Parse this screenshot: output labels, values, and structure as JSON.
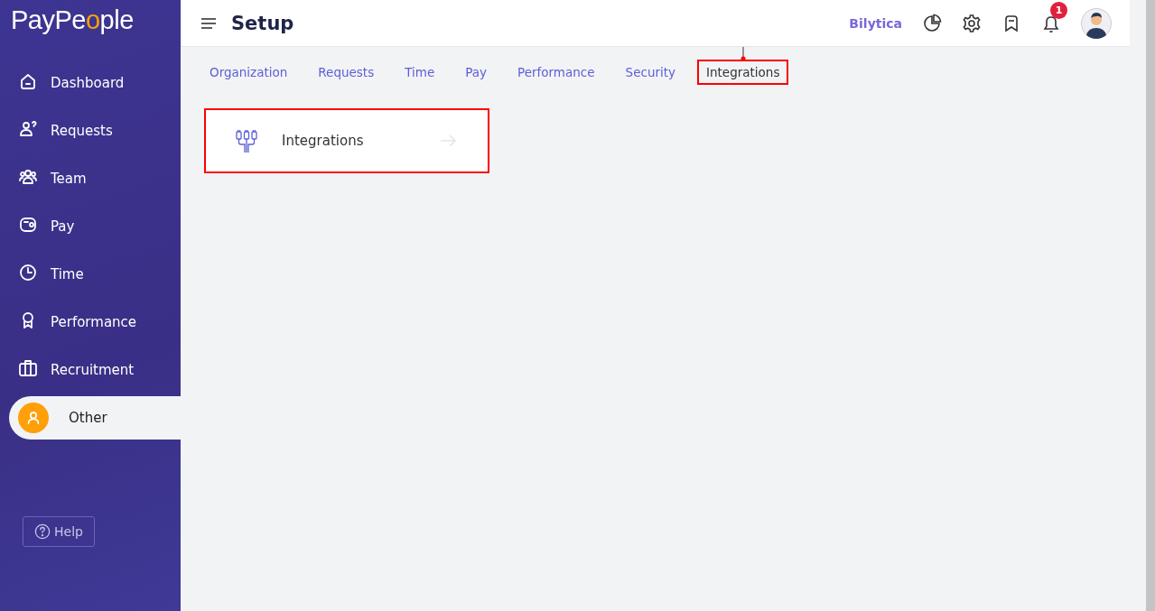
{
  "logo": [
    "PayPe",
    "o",
    "ple"
  ],
  "sidebar": {
    "items": [
      {
        "label": "Dashboard",
        "selected": false
      },
      {
        "label": "Requests",
        "selected": false
      },
      {
        "label": "Team",
        "selected": false
      },
      {
        "label": "Pay",
        "selected": false
      },
      {
        "label": "Time",
        "selected": false
      },
      {
        "label": "Performance",
        "selected": false
      },
      {
        "label": "Recruitment",
        "selected": false
      },
      {
        "label": "Other",
        "selected": true
      }
    ],
    "help": "Help"
  },
  "header": {
    "title": "Setup",
    "company": "Bilytica",
    "notification_count": "1"
  },
  "tabs": [
    {
      "label": "Organization",
      "selected": false,
      "highlighted": false
    },
    {
      "label": "Requests",
      "selected": false,
      "highlighted": false
    },
    {
      "label": "Time",
      "selected": false,
      "highlighted": false
    },
    {
      "label": "Pay",
      "selected": false,
      "highlighted": false
    },
    {
      "label": "Performance",
      "selected": false,
      "highlighted": false
    },
    {
      "label": "Security",
      "selected": false,
      "highlighted": false
    },
    {
      "label": "Integrations",
      "selected": true,
      "highlighted": true
    }
  ],
  "cards": [
    {
      "label": "Integrations",
      "highlighted": true
    }
  ]
}
